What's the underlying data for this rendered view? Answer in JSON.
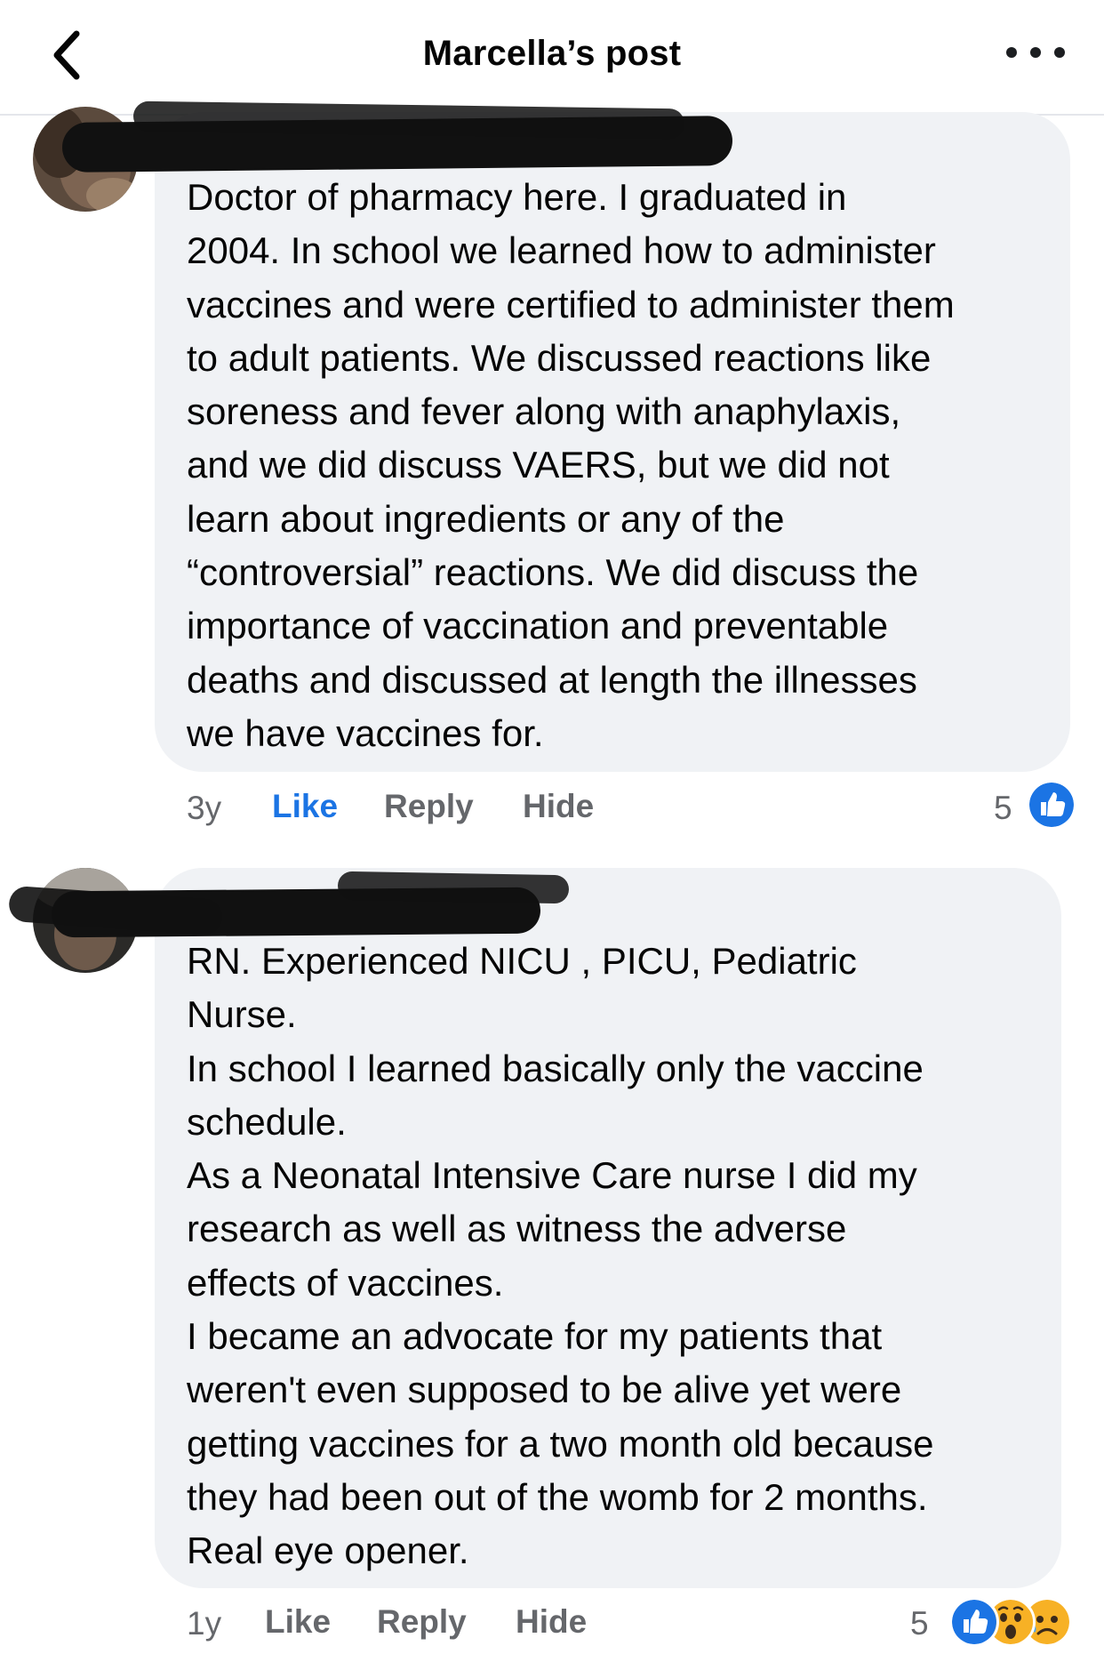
{
  "header": {
    "title": "Marcella’s post"
  },
  "comments": [
    {
      "text": "Doctor of pharmacy here.  I graduated in\n2004. In school we learned how to administer\nvaccines and were certified to administer them\nto adult patients.  We discussed reactions like\nsoreness and fever along with anaphylaxis,\nand we did discuss VAERS, but we did not\nlearn about ingredients or any of the\n“controversial” reactions.   We did discuss the\nimportance of vaccination and preventable\ndeaths and discussed at length the illnesses\nwe have vaccines for.",
      "time": "3y",
      "like_label": "Like",
      "like_active": true,
      "reply_label": "Reply",
      "hide_label": "Hide",
      "reaction_count": "5",
      "reactions": [
        "like-icon"
      ]
    },
    {
      "text": "RN. Experienced NICU , PICU,  Pediatric\nNurse.\nIn school I learned basically only the vaccine\nschedule.\nAs a Neonatal Intensive Care nurse I did my\nresearch as well as witness the adverse\neffects of vaccines.\nI became an advocate for my patients that\nweren't even supposed to be alive yet were\ngetting  vaccines for a two month old because\nthey had been out of the womb for 2 months.\nReal eye opener.",
      "time": "1y",
      "like_label": "Like",
      "like_active": false,
      "reply_label": "Reply",
      "hide_label": "Hide",
      "reaction_count": "5",
      "reactions": [
        "like-icon",
        "wow-icon",
        "sad-icon"
      ]
    }
  ],
  "colors": {
    "like_blue": "#1b74e4",
    "meta_gray": "#65676b",
    "bubble_bg": "#f0f2f5",
    "redaction": "#111111"
  }
}
